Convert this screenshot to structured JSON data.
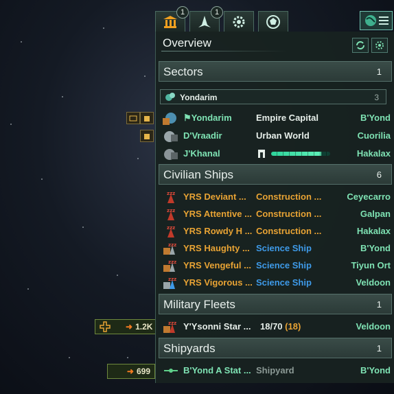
{
  "top_tabs": [
    {
      "name": "government",
      "badge": "1"
    },
    {
      "name": "ships",
      "badge": "1"
    },
    {
      "name": "settings",
      "badge": ""
    },
    {
      "name": "contacts",
      "badge": ""
    }
  ],
  "panel": {
    "title": "Overview"
  },
  "sections": {
    "sectors": {
      "label": "Sectors",
      "count": "1"
    },
    "civilian": {
      "label": "Civilian Ships",
      "count": "6"
    },
    "military": {
      "label": "Military Fleets",
      "count": "1"
    },
    "shipyards": {
      "label": "Shipyards",
      "count": "1"
    }
  },
  "sector": {
    "label": "Yondarim",
    "count": "3"
  },
  "planets": [
    {
      "name": "Yondarim",
      "type": "Empire Capital",
      "system": "B'Yond"
    },
    {
      "name": "D'Vraadir",
      "type": "Urban World",
      "system": "Cuorilia"
    },
    {
      "name": "J'Khanal",
      "type": "",
      "system": "Hakalax",
      "progress": 0.85
    }
  ],
  "civilian_ships": [
    {
      "name": "YRS Deviant ...",
      "task": "Construction ...",
      "location": "Ceyecarro"
    },
    {
      "name": "YRS Attentive ...",
      "task": "Construction ...",
      "location": "Galpan"
    },
    {
      "name": "YRS Rowdy H ...",
      "task": "Construction ...",
      "location": "Hakalax"
    },
    {
      "name": "YRS Haughty ...",
      "task": "Science Ship",
      "location": "B'Yond"
    },
    {
      "name": "YRS Vengeful ...",
      "task": "Science Ship",
      "location": "Tiyun Ort"
    },
    {
      "name": "YRS Vigorous ...",
      "task": "Science Ship",
      "location": "Veldoon"
    }
  ],
  "fleet": {
    "name": "Y'Ysonni Star ...",
    "size": "18/70",
    "size_extra": "(18)",
    "location": "Veldoon"
  },
  "shipyard": {
    "name": "B'Yond A Stat ...",
    "type": "Shipyard",
    "location": "B'Yond"
  },
  "left_widgets": {
    "fleet_power_1": "1.2K",
    "fleet_power_2": "699"
  },
  "colors": {
    "accent_green": "#7fe3b4",
    "ship_orange": "#e8a334",
    "science_blue": "#3e9ae8"
  }
}
